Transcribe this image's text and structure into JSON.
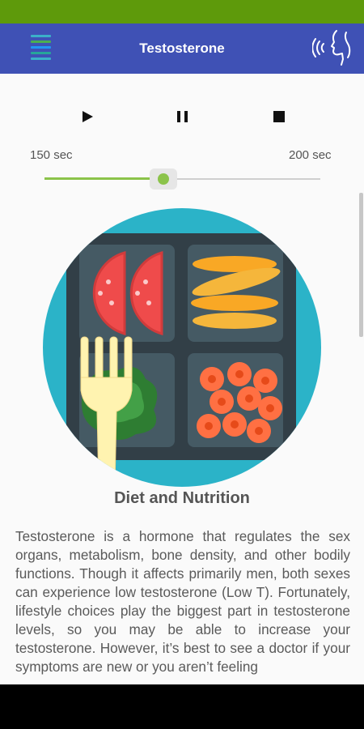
{
  "app_bar": {
    "title": "Testosterone",
    "menu_icon": "hamburger-menu-icon",
    "voice_icon": "speaking-head-icon",
    "color": "#3f51b5"
  },
  "status_bar": {
    "color": "#5e9a0b"
  },
  "player": {
    "play_icon": "play-icon",
    "pause_icon": "pause-icon",
    "stop_icon": "stop-icon",
    "time_left": "150 sec",
    "time_right": "200 sec",
    "slider_fraction": 0.43,
    "accent_color": "#8bc34a"
  },
  "article": {
    "image_icon": "diet-nutrition-tray-illustration",
    "heading": "Diet and Nutrition",
    "body": "Testosterone is a hormone that regulates the sex organs, metabolism, bone density, and other bodily functions. Though it affects primarily men, both sexes can experience low testosterone (Low T). Fortunately, lifestyle choices play the biggest part in testosterone levels, so you may be able to increase your testosterone. However, it’s best to see a doctor if your symptoms are new or you aren’t feeling"
  }
}
